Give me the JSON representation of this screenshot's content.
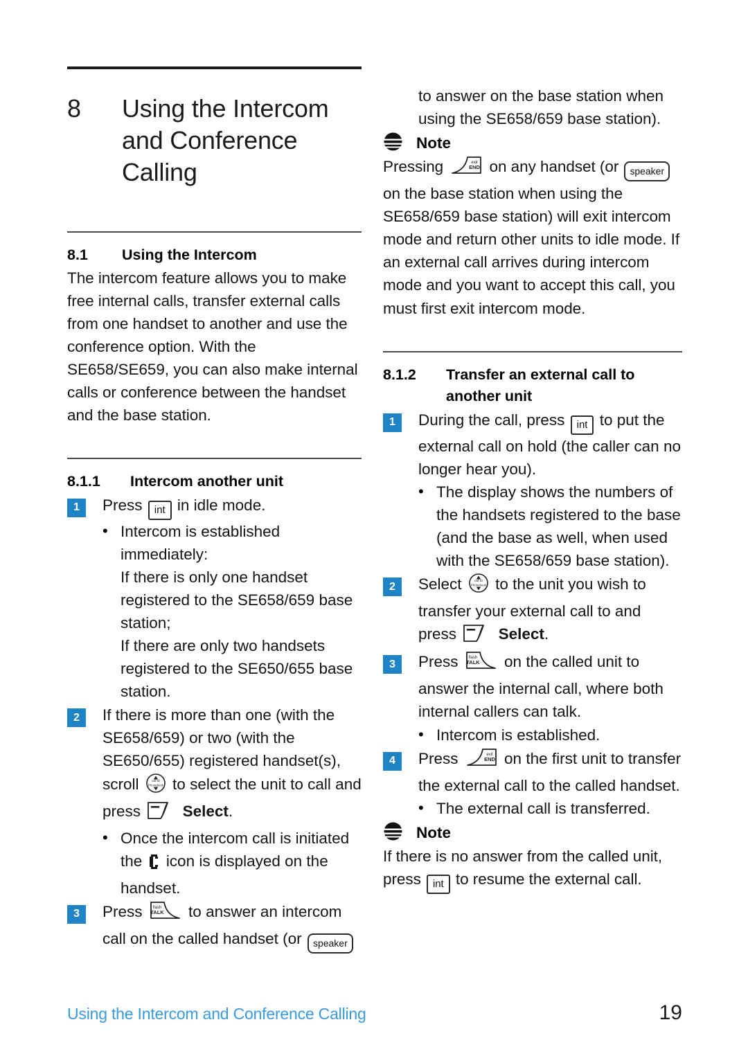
{
  "document": {
    "chapter_number": "8",
    "chapter_title_lines": [
      "Using the Intercom",
      "and Conference",
      "Calling"
    ],
    "chapter_title": "Using the Intercom and Conference Calling"
  },
  "left_column": {
    "section_8_1": {
      "number": "8.1",
      "title": "Using the Intercom",
      "body": "The intercom feature allows you to make free internal calls, transfer external calls from one handset to another and use the conference option. With the SE658/SE659, you can also make internal calls or conference between the handset and the base station."
    },
    "section_8_1_1": {
      "number": "8.1.1",
      "title": "Intercom another unit",
      "step1": {
        "badge": "1",
        "text_before": "Press",
        "key": "int",
        "text_after": "in idle mode.",
        "bullet": "Intercom is established immediately:",
        "sub1": "If there is only one handset registered to the SE658/659 base station;",
        "sub2": "If there are only two handsets registered to the SE650/655 base station."
      },
      "step2": {
        "badge": "2",
        "text_before": "If there is more than one (with the SE658/659) or two (with the SE650/655) registered handset(s), scroll",
        "nav_icon": "navigation-scroll-key",
        "text_middle": "to select the unit to call and press",
        "softkey_icon": "left-softkey",
        "softkey_label": "Select",
        "text_after": ".",
        "bullet_before": "Once the intercom call is initiated the",
        "bullet_icon": "handset-phone-icon",
        "bullet_after": "icon is displayed on the handset."
      },
      "step3": {
        "badge": "3",
        "text_before": "Press",
        "key_icon": "flash-talk-key",
        "text_after": "to answer an intercom call on the called handset (or",
        "key_speaker": "speaker"
      }
    }
  },
  "right_column": {
    "continuation": "to answer on the base station when using the SE658/659 base station).",
    "note1": {
      "label": "Note",
      "text_before": "Pressing",
      "key_icon": "exit-end-key",
      "text_middle": "on any handset (or",
      "key_speaker": "speaker",
      "text_after": "on the base station when using the SE658/659 base station) will exit intercom mode and return other units to idle mode. If an external call arrives during intercom mode and you want to accept this call, you must first exit intercom mode."
    },
    "section_8_1_2": {
      "number": "8.1.2",
      "title_lines": [
        "Transfer an external call to",
        "another unit"
      ],
      "title": "Transfer an external call to another unit",
      "step1": {
        "badge": "1",
        "text_before": "During the call, press",
        "key": "int",
        "text_after": "to put the external call on hold (the caller can no longer hear you).",
        "bullet": "The display shows the numbers of the handsets registered to the base (and the base as well, when used with the SE658/659 base station)."
      },
      "step2": {
        "badge": "2",
        "text_before": "Select",
        "nav_icon": "navigation-scroll-key",
        "text_middle": "to the unit you wish to transfer your external call to and press",
        "softkey_icon": "left-softkey",
        "softkey_label": "Select",
        "text_after": "."
      },
      "step3": {
        "badge": "3",
        "text_before": "Press",
        "key_icon": "flash-talk-key",
        "text_after": "on the called unit to answer the internal call, where both internal callers can talk.",
        "bullet": "Intercom is established."
      },
      "step4": {
        "badge": "4",
        "text_before": "Press",
        "key_icon": "exit-end-key",
        "text_after": "on the first unit to transfer the external call to the called handset.",
        "bullet": "The external call is transferred."
      }
    },
    "note2": {
      "label": "Note",
      "text_before": "If there is no answer from the called unit, press",
      "key": "int",
      "text_after": "to resume the external call."
    }
  },
  "footer": {
    "text": "Using the Intercom and Conference Calling",
    "page": "19"
  },
  "colors": {
    "badge_blue": "#1f84c6",
    "footer_blue": "#3a9ade",
    "rule_dark": "#1a1a1a",
    "text": "#141414"
  },
  "keys": {
    "int_label": "int",
    "speaker_label": "speaker",
    "talk_line1": "flash",
    "talk_line2": "TALK",
    "end_line1": "exit",
    "end_line2": "END",
    "nav_line1": "call ID",
    "nav_line2": "Phonebook"
  }
}
